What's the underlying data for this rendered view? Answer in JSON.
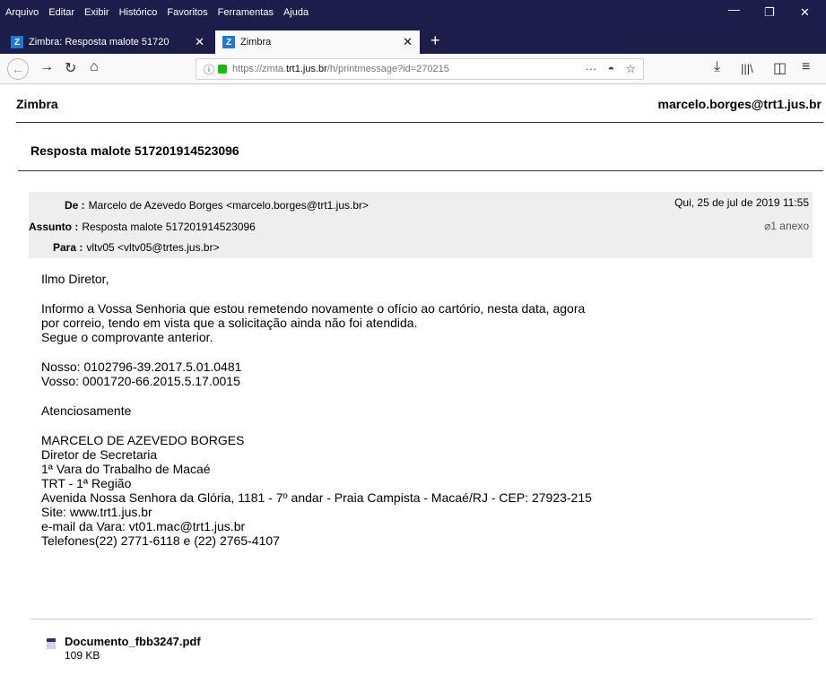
{
  "browser": {
    "menu": [
      "Arquivo",
      "Editar",
      "Exibir",
      "Histórico",
      "Favoritos",
      "Ferramentas",
      "Ajuda"
    ],
    "tabs": [
      {
        "title": "Zimbra: Resposta malote 51720",
        "favicon": "Z"
      },
      {
        "title": "Zimbra",
        "favicon": "Z"
      }
    ],
    "url_prefix": "https://zmta.",
    "url_domain": "trt1.jus.br",
    "url_path": "/h/printmessage?id=270215"
  },
  "page": {
    "app_name": "Zimbra",
    "user_email": "marcelo.borges@trt1.jus.br",
    "subject_title": "Resposta malote 517201914523096"
  },
  "message": {
    "from_label": "De :",
    "from_value": "Marcelo de Azevedo Borges <marcelo.borges@trt1.jus.br>",
    "subject_label": "Assunto :",
    "subject_value": "Resposta malote 517201914523096",
    "to_label": "Para :",
    "to_value": "vltv05 <vltv05@trtes.jus.br>",
    "date": "Qui, 25 de jul de 2019 11:55",
    "attachments_count": "1 anexo",
    "body": {
      "greeting": "Ilmo Diretor,",
      "p1_l1": "Informo a Vossa Senhoria que estou remetendo novamente o ofício ao cartório, nesta data, agora",
      "p1_l2": "por correio, tendo em vista que a solicitação ainda não foi atendida.",
      "p1_l3": "Segue o comprovante anterior.",
      "nosso": "Nosso: 0102796-39.2017.5.01.0481",
      "vosso": "Vosso: 0001720-66.2015.5.17.0015",
      "closing": "Atenciosamente",
      "sig_name": "MARCELO DE AZEVEDO BORGES",
      "sig_role": "Diretor de Secretaria",
      "sig_org": "1ª Vara do Trabalho de Macaé",
      "sig_region": "TRT - 1ª Região",
      "sig_address": "Avenida Nossa Senhora da Glória, 1181 - 7º andar - Praia Campista - Macaé/RJ - CEP: 27923-215",
      "sig_site": "Site: www.trt1.jus.br",
      "sig_email": "e-mail da Vara:  vt01.mac@trt1.jus.br",
      "sig_phones": "Telefones(22) 2771-6118 e (22) 2765-4107"
    },
    "attachment": {
      "name": "Documento_fbb3247.pdf",
      "size": "109 KB"
    }
  }
}
